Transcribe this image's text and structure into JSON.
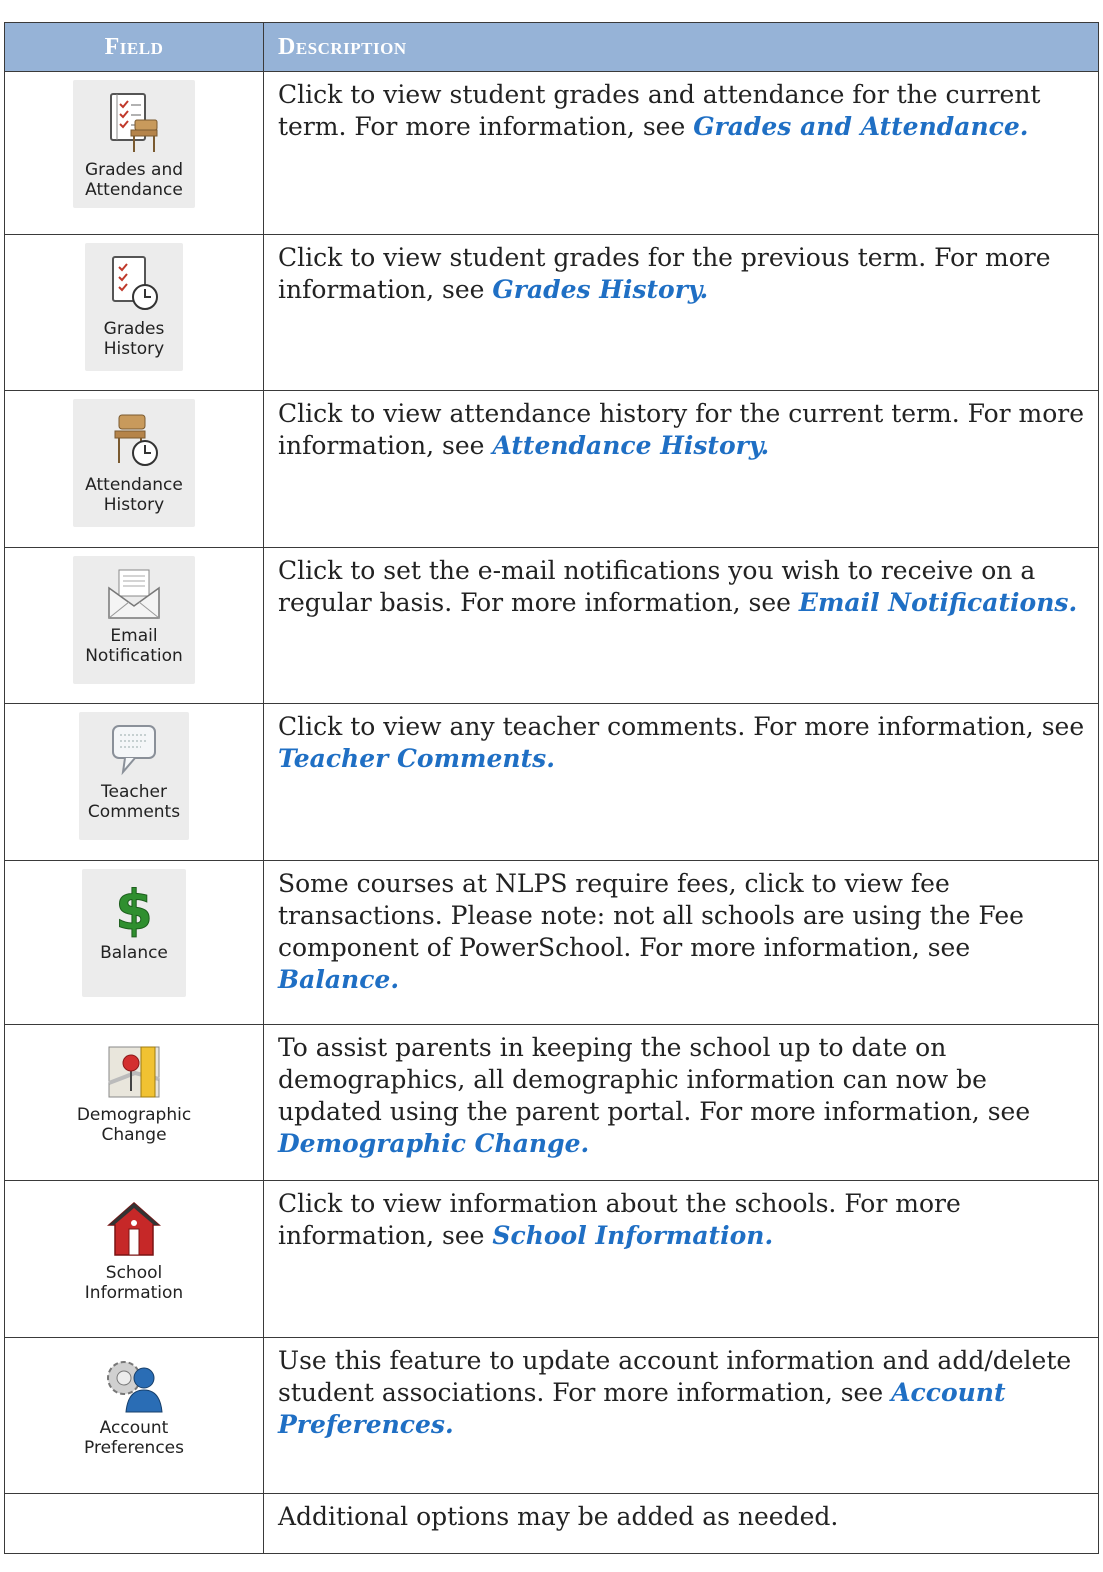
{
  "header": {
    "field": "Field",
    "description": "Description"
  },
  "rows": [
    {
      "icon": "grades-attendance-icon",
      "label": "Grades and\nAttendance",
      "text": "Click to view student grades and attendance for the current term.  For more information, see ",
      "link": "Grades and Attendance."
    },
    {
      "icon": "grades-history-icon",
      "label": "Grades\nHistory",
      "text": "Click to view student grades for the previous term.  For more information, see ",
      "link": "Grades History."
    },
    {
      "icon": "attendance-history-icon",
      "label": "Attendance\nHistory",
      "text": "Click to view attendance history for the current term.  For more information, see ",
      "link": "Attendance History."
    },
    {
      "icon": "email-notification-icon",
      "label": "Email\nNotification",
      "text": "Click to set the e-mail notifications you wish to receive on a regular basis.  For more information, see ",
      "link": "Email Notifications."
    },
    {
      "icon": "teacher-comments-icon",
      "label": "Teacher\nComments",
      "text": "Click to view any teacher comments.  For more information, see ",
      "link": "Teacher Comments."
    },
    {
      "icon": "balance-dollar-icon",
      "label": "Balance",
      "text": "Some courses at NLPS require fees, click to view fee transactions.   Please note: not all schools are using the Fee component of PowerSchool.  For more information, see ",
      "link": "Balance."
    },
    {
      "icon": "demographic-change-icon",
      "label": "Demographic\nChange",
      "text": "To assist parents in keeping the school up to date on demographics, all demographic information can now be updated using the parent portal.  For more information, see ",
      "link": "Demographic Change."
    },
    {
      "icon": "school-information-icon",
      "label": "School\nInformation",
      "text": "Click to view information about the schools.  For more information, see ",
      "link": "School Information."
    },
    {
      "icon": "account-preferences-icon",
      "label": "Account\nPreferences",
      "text": "Use this feature to update account information and add/delete student associations.  For more information, see ",
      "link": "Account Preferences."
    },
    {
      "icon": "",
      "label": "",
      "text": "Additional options may be added as needed.",
      "link": ""
    }
  ],
  "colors": {
    "header_bg": "#96b3d7",
    "link": "#1f6fc4"
  }
}
